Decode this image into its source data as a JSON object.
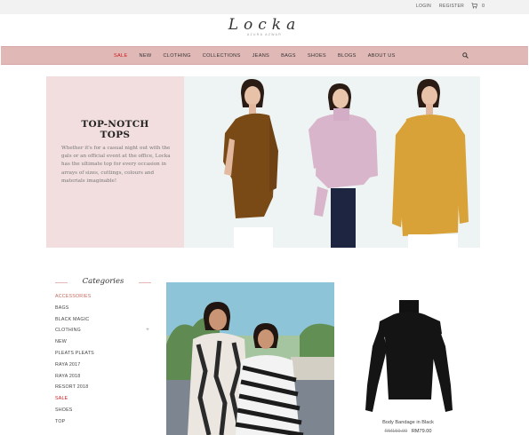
{
  "topbar": {
    "login": "LOGIN",
    "register": "REGISTER",
    "cart_count": "0"
  },
  "logo": {
    "brand": "Locka",
    "tagline": "AZURA AZWAR"
  },
  "nav": {
    "items": [
      {
        "label": "SALE",
        "active": true
      },
      {
        "label": "NEW"
      },
      {
        "label": "CLOTHING"
      },
      {
        "label": "COLLECTIONS"
      },
      {
        "label": "JEANS"
      },
      {
        "label": "BAGS"
      },
      {
        "label": "SHOES"
      },
      {
        "label": "BLOGS"
      },
      {
        "label": "ABOUT US"
      }
    ]
  },
  "hero": {
    "title_line1": "TOP-NOTCH",
    "title_line2": "TOPS",
    "text": "Whether it's for a casual night out with the gals or an official event at the office, Locka has the ultimate top for every occasion in arrays of sizes, cuttings, colours and materials imaginable!"
  },
  "sidebar": {
    "title": "Categories",
    "items": [
      {
        "label": "ACCESSORIES"
      },
      {
        "label": "BAGS"
      },
      {
        "label": "BLACK MAGIC"
      },
      {
        "label": "CLOTHING",
        "expand": "+"
      },
      {
        "label": "NEW"
      },
      {
        "label": "PLEATS PLEATS"
      },
      {
        "label": "RAYA 2017"
      },
      {
        "label": "RAYA 2018"
      },
      {
        "label": "RESORT 2018"
      },
      {
        "label": "SALE"
      },
      {
        "label": "SHOES"
      },
      {
        "label": "TOP"
      }
    ]
  },
  "product": {
    "name": "Body Bandage in Black",
    "old_price": "RM159.00",
    "new_price": "RM79.00"
  },
  "colors": {
    "nav_bg": "#e0b8b6",
    "hero_panel": "#f2dede",
    "sale_red": "#d0161b",
    "accent": "#c26a5f"
  },
  "icons": {
    "cart": "cart-icon",
    "search": "search-icon"
  }
}
